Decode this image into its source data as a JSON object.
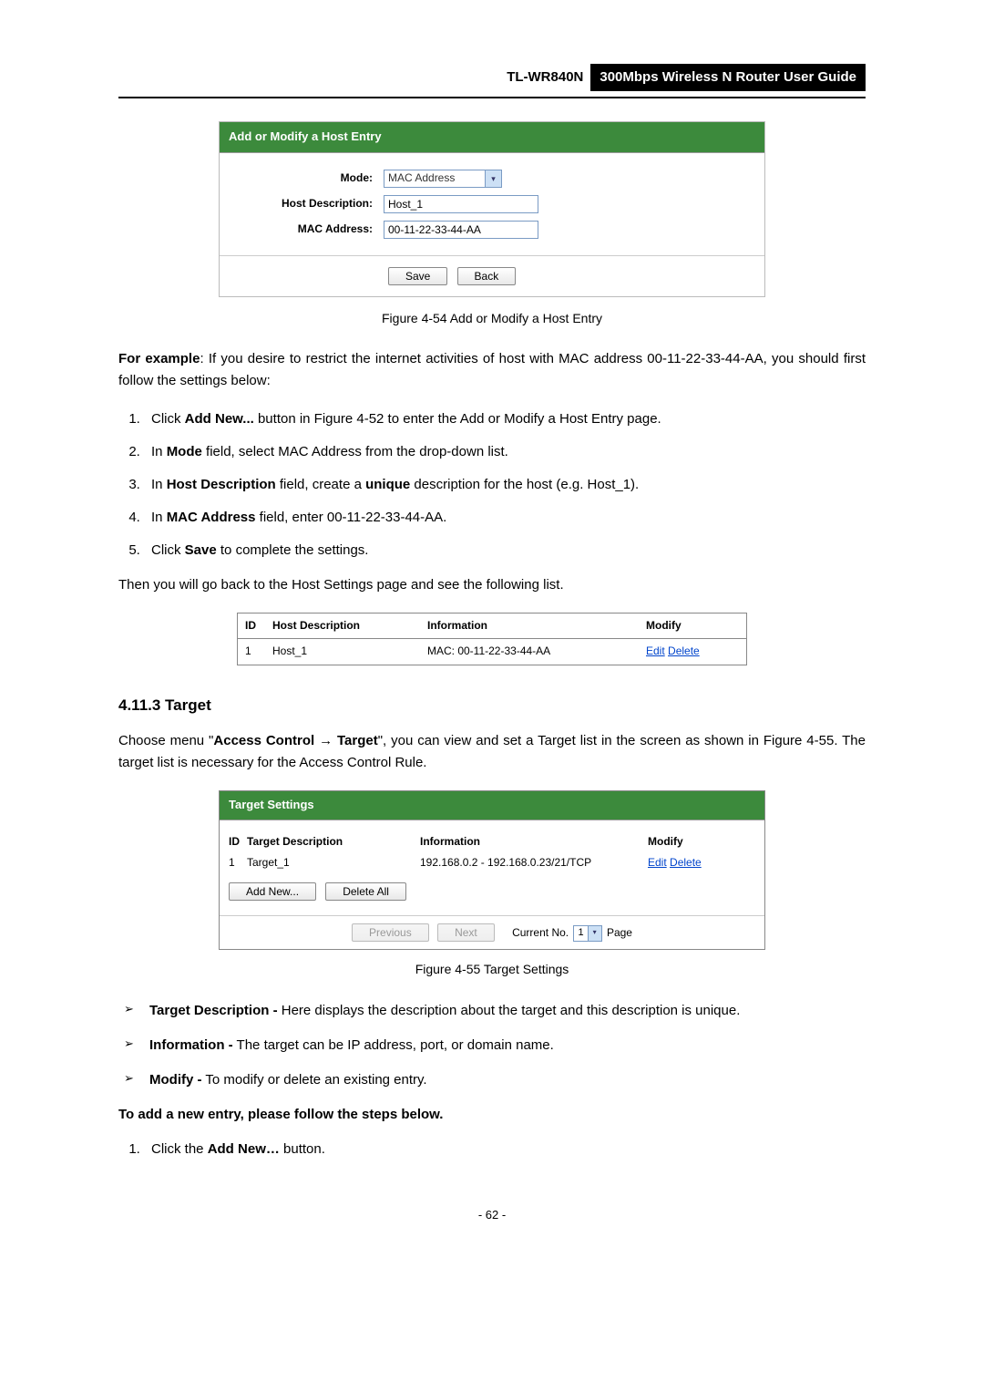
{
  "header": {
    "model": "TL-WR840N",
    "title": "300Mbps Wireless N Router User Guide"
  },
  "figure1": {
    "panel_title": "Add or Modify a Host Entry",
    "labels": {
      "mode": "Mode:",
      "host_desc": "Host Description:",
      "mac": "MAC Address:"
    },
    "values": {
      "mode": "MAC Address",
      "host_desc": "Host_1",
      "mac": "00-11-22-33-44-AA"
    },
    "buttons": {
      "save": "Save",
      "back": "Back"
    },
    "caption": "Figure 4-54    Add or Modify a Host Entry"
  },
  "paragraph1_prefix": "For example",
  "paragraph1_rest": ": If you desire to restrict the internet activities of host with MAC address 00-11-22-33-44-AA, you should first follow the settings below:",
  "steps1": {
    "s1a": "Click ",
    "s1b": "Add New...",
    "s1c": " button in Figure 4-52 to enter the Add or Modify a Host Entry page.",
    "s2a": "In ",
    "s2b": "Mode",
    "s2c": " field, select MAC Address from the drop-down list.",
    "s3a": "In ",
    "s3b": "Host Description",
    "s3c": " field, create a ",
    "s3d": "unique",
    "s3e": " description for the host (e.g. Host_1).",
    "s4a": "In ",
    "s4b": "MAC Address",
    "s4c": " field, enter 00-11-22-33-44-AA.",
    "s5a": "Click ",
    "s5b": "Save",
    "s5c": " to complete the settings."
  },
  "paragraph2": "Then you will go back to the Host Settings page and see the following list.",
  "host_table": {
    "headers": {
      "id": "ID",
      "desc": "Host Description",
      "info": "Information",
      "modify": "Modify"
    },
    "row": {
      "id": "1",
      "desc": "Host_1",
      "info": "MAC: 00-11-22-33-44-AA",
      "edit": "Edit",
      "delete": "Delete"
    }
  },
  "section_heading": "4.11.3 Target",
  "paragraph3a": "Choose menu \"",
  "paragraph3b": "Access Control",
  "paragraph3arrow": " → ",
  "paragraph3c": "Target",
  "paragraph3d": "\", you can view and set a Target list in the screen as shown in Figure 4-55. The target list is necessary for the Access Control Rule.",
  "figure2": {
    "panel_title": "Target Settings",
    "headers": {
      "id": "ID",
      "desc": "Target Description",
      "info": "Information",
      "modify": "Modify"
    },
    "row": {
      "id": "1",
      "desc": "Target_1",
      "info": "192.168.0.2 - 192.168.0.23/21/TCP",
      "edit": "Edit",
      "delete": "Delete"
    },
    "buttons": {
      "add": "Add New...",
      "delete_all": "Delete All",
      "prev": "Previous",
      "next": "Next"
    },
    "pager": {
      "label": "Current No.",
      "value": "1",
      "suffix": "Page"
    },
    "caption": "Figure 4-55    Target Settings"
  },
  "bullets": {
    "b1a": "Target Description -",
    "b1b": " Here displays the description about the target and this description is unique.",
    "b2a": "Information -",
    "b2b": " The target can be IP address, port, or domain name.",
    "b3a": "Modify -",
    "b3b": " To modify or delete an existing entry."
  },
  "paragraph4": "To add a new entry, please follow the steps below.",
  "steps2": {
    "s1a": "Click the ",
    "s1b": "Add New…",
    "s1c": " button."
  },
  "page_number": "- 62 -"
}
